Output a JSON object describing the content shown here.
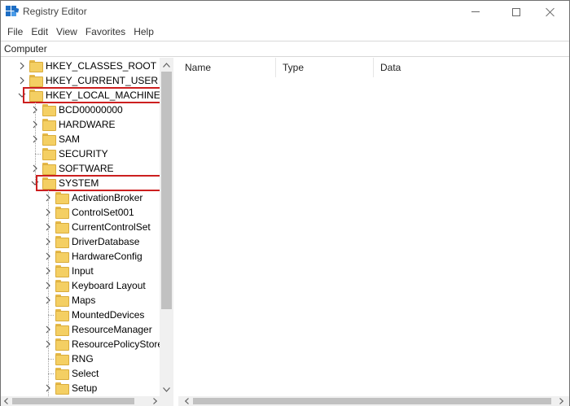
{
  "window": {
    "title": "Registry Editor",
    "icon": "registry-editor-icon"
  },
  "menu": [
    "File",
    "Edit",
    "View",
    "Favorites",
    "Help"
  ],
  "address": "Computer",
  "tree": {
    "items": [
      {
        "label": "HKEY_CLASSES_ROOT",
        "level": 1,
        "expander": "collapsed",
        "highlighted": false
      },
      {
        "label": "HKEY_CURRENT_USER",
        "level": 1,
        "expander": "collapsed",
        "highlighted": false
      },
      {
        "label": "HKEY_LOCAL_MACHINE",
        "level": 1,
        "expander": "expanded",
        "highlighted": true
      },
      {
        "label": "BCD00000000",
        "level": 2,
        "expander": "collapsed",
        "highlighted": false
      },
      {
        "label": "HARDWARE",
        "level": 2,
        "expander": "collapsed",
        "highlighted": false
      },
      {
        "label": "SAM",
        "level": 2,
        "expander": "collapsed",
        "highlighted": false
      },
      {
        "label": "SECURITY",
        "level": 2,
        "expander": "none",
        "highlighted": false
      },
      {
        "label": "SOFTWARE",
        "level": 2,
        "expander": "collapsed",
        "highlighted": false
      },
      {
        "label": "SYSTEM",
        "level": 2,
        "expander": "expanded",
        "highlighted": true
      },
      {
        "label": "ActivationBroker",
        "level": 3,
        "expander": "collapsed",
        "highlighted": false
      },
      {
        "label": "ControlSet001",
        "level": 3,
        "expander": "collapsed",
        "highlighted": false
      },
      {
        "label": "CurrentControlSet",
        "level": 3,
        "expander": "collapsed",
        "highlighted": false
      },
      {
        "label": "DriverDatabase",
        "level": 3,
        "expander": "collapsed",
        "highlighted": false
      },
      {
        "label": "HardwareConfig",
        "level": 3,
        "expander": "collapsed",
        "highlighted": false
      },
      {
        "label": "Input",
        "level": 3,
        "expander": "collapsed",
        "highlighted": false
      },
      {
        "label": "Keyboard Layout",
        "level": 3,
        "expander": "collapsed",
        "highlighted": false
      },
      {
        "label": "Maps",
        "level": 3,
        "expander": "collapsed",
        "highlighted": false
      },
      {
        "label": "MountedDevices",
        "level": 3,
        "expander": "none",
        "highlighted": false
      },
      {
        "label": "ResourceManager",
        "level": 3,
        "expander": "collapsed",
        "highlighted": false
      },
      {
        "label": "ResourcePolicyStore",
        "level": 3,
        "expander": "collapsed",
        "highlighted": false
      },
      {
        "label": "RNG",
        "level": 3,
        "expander": "none",
        "highlighted": false
      },
      {
        "label": "Select",
        "level": 3,
        "expander": "none",
        "highlighted": false
      },
      {
        "label": "Setup",
        "level": 3,
        "expander": "collapsed",
        "highlighted": false
      }
    ]
  },
  "list": {
    "columns": [
      "Name",
      "Type",
      "Data"
    ]
  },
  "colors": {
    "highlight": "#cc1f1f",
    "folder": "#f4cf63"
  }
}
